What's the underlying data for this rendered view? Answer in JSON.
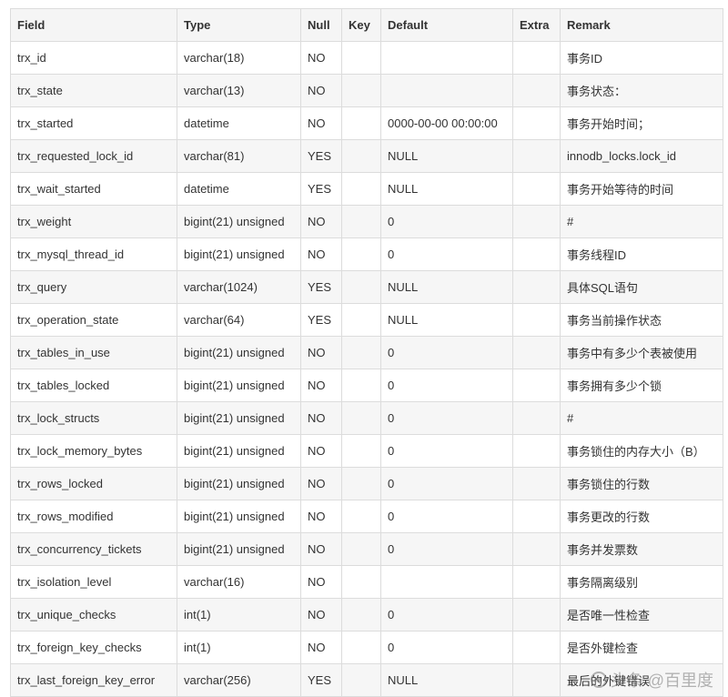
{
  "table": {
    "headers": [
      "Field",
      "Type",
      "Null",
      "Key",
      "Default",
      "Extra",
      "Remark"
    ],
    "rows": [
      [
        "trx_id",
        "varchar(18)",
        "NO",
        "",
        "",
        "",
        "事务ID"
      ],
      [
        "trx_state",
        "varchar(13)",
        "NO",
        "",
        "",
        "",
        "事务状态："
      ],
      [
        "trx_started",
        "datetime",
        "NO",
        "",
        "0000-00-00 00:00:00",
        "",
        "事务开始时间；"
      ],
      [
        "trx_requested_lock_id",
        "varchar(81)",
        "YES",
        "",
        "NULL",
        "",
        "innodb_locks.lock_id"
      ],
      [
        "trx_wait_started",
        "datetime",
        "YES",
        "",
        "NULL",
        "",
        "事务开始等待的时间"
      ],
      [
        "trx_weight",
        "bigint(21) unsigned",
        "NO",
        "",
        "0",
        "",
        "#"
      ],
      [
        "trx_mysql_thread_id",
        "bigint(21) unsigned",
        "NO",
        "",
        "0",
        "",
        "事务线程ID"
      ],
      [
        "trx_query",
        "varchar(1024)",
        "YES",
        "",
        "NULL",
        "",
        "具体SQL语句"
      ],
      [
        "trx_operation_state",
        "varchar(64)",
        "YES",
        "",
        "NULL",
        "",
        "事务当前操作状态"
      ],
      [
        "trx_tables_in_use",
        "bigint(21) unsigned",
        "NO",
        "",
        "0",
        "",
        "事务中有多少个表被使用"
      ],
      [
        "trx_tables_locked",
        "bigint(21) unsigned",
        "NO",
        "",
        "0",
        "",
        "事务拥有多少个锁"
      ],
      [
        "trx_lock_structs",
        "bigint(21) unsigned",
        "NO",
        "",
        "0",
        "",
        "#"
      ],
      [
        "trx_lock_memory_bytes",
        "bigint(21) unsigned",
        "NO",
        "",
        "0",
        "",
        "事务锁住的内存大小（B）"
      ],
      [
        "trx_rows_locked",
        "bigint(21) unsigned",
        "NO",
        "",
        "0",
        "",
        "事务锁住的行数"
      ],
      [
        "trx_rows_modified",
        "bigint(21) unsigned",
        "NO",
        "",
        "0",
        "",
        "事务更改的行数"
      ],
      [
        "trx_concurrency_tickets",
        "bigint(21) unsigned",
        "NO",
        "",
        "0",
        "",
        "事务并发票数"
      ],
      [
        "trx_isolation_level",
        "varchar(16)",
        "NO",
        "",
        "",
        "",
        "事务隔离级别"
      ],
      [
        "trx_unique_checks",
        "int(1)",
        "NO",
        "",
        "0",
        "",
        "是否唯一性检查"
      ],
      [
        "trx_foreign_key_checks",
        "int(1)",
        "NO",
        "",
        "0",
        "",
        "是否外键检查"
      ],
      [
        "trx_last_foreign_key_error",
        "varchar(256)",
        "YES",
        "",
        "NULL",
        "",
        "最后的外键错误"
      ]
    ]
  },
  "watermark": {
    "text": "头条 @百里度"
  },
  "colors": {
    "border": "#dcdcdc",
    "header_bg": "#f5f5f5",
    "stripe_bg": "#f6f6f6",
    "text": "#333333"
  }
}
